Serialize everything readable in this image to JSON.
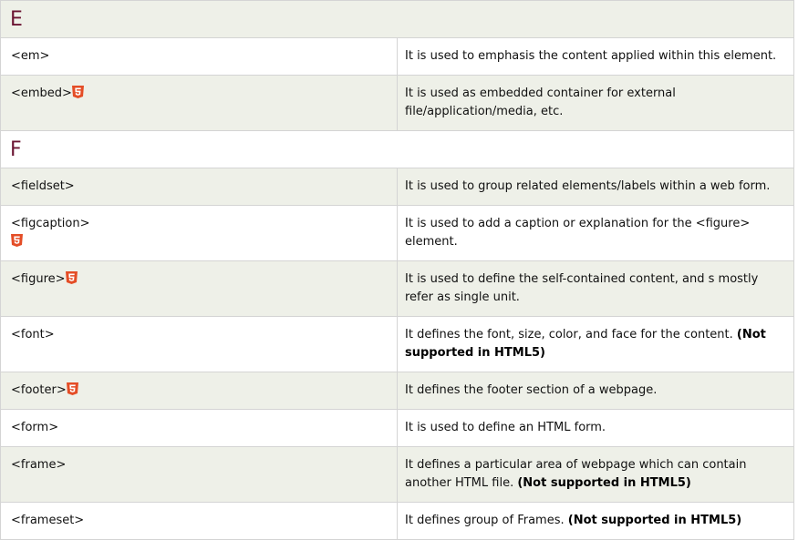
{
  "colors": {
    "letter_heading": "#6b1432",
    "tag_text": "#2e7d20",
    "row_gray": "#eef0e8",
    "row_white": "#ffffff",
    "html5_badge": "#e44d26"
  },
  "sections": [
    {
      "letter": "E",
      "rows": [
        {
          "tag": "<em>",
          "html5": false,
          "desc": "It is used to emphasis the content applied within this element.",
          "note": ""
        },
        {
          "tag": "<embed>",
          "html5": true,
          "desc": "It is used as embedded container for external file/application/media, etc.",
          "note": ""
        }
      ]
    },
    {
      "letter": "F",
      "rows": [
        {
          "tag": "<fieldset>",
          "html5": false,
          "desc": "It is used to group related elements/labels within a web form.",
          "note": ""
        },
        {
          "tag": "<figcaption>",
          "html5": true,
          "desc": "It is used to add a caption or explanation for the <figure> element.",
          "note": ""
        },
        {
          "tag": "<figure>",
          "html5": true,
          "desc": "It is used to define the self-contained content, and s mostly refer as single unit.",
          "note": ""
        },
        {
          "tag": "<font>",
          "html5": false,
          "desc": "It defines the font, size, color, and face for the content. ",
          "note": "(Not supported in HTML5)"
        },
        {
          "tag": "<footer>",
          "html5": true,
          "desc": "It defines the footer section of a webpage.",
          "note": ""
        },
        {
          "tag": "<form>",
          "html5": false,
          "desc": "It is used to define an HTML form.",
          "note": ""
        },
        {
          "tag": "<frame>",
          "html5": false,
          "desc": "It defines a particular area of webpage which can contain another HTML file. ",
          "note": "(Not supported in HTML5)"
        },
        {
          "tag": "<frameset>",
          "html5": false,
          "desc": "It defines group of Frames. ",
          "note": "(Not supported in HTML5)"
        }
      ]
    }
  ]
}
